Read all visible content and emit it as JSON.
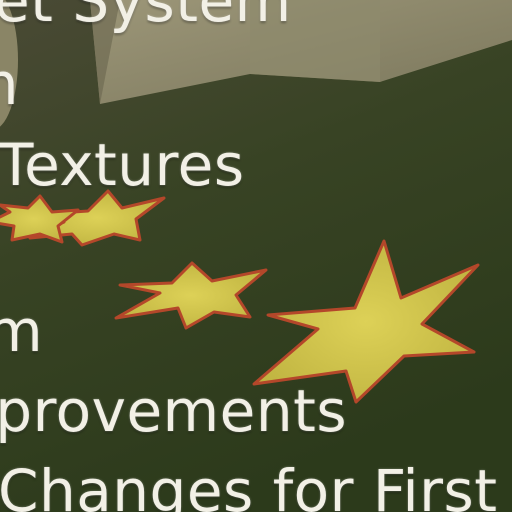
{
  "scene": {
    "icon": "eu-stars-flag",
    "colors": {
      "background": "#33401f",
      "flag_block": "#8a8668",
      "star_fill": "#cfc34a",
      "star_edge": "#b4472a",
      "menu_text": "#f2f0e6"
    }
  },
  "menu": {
    "items": [
      {
        "label": "et System"
      },
      {
        "label": "m"
      },
      {
        "label": "Textures"
      },
      {
        "label": "em"
      },
      {
        "label": "nprovements"
      },
      {
        "label": "Changes for First A"
      }
    ]
  }
}
